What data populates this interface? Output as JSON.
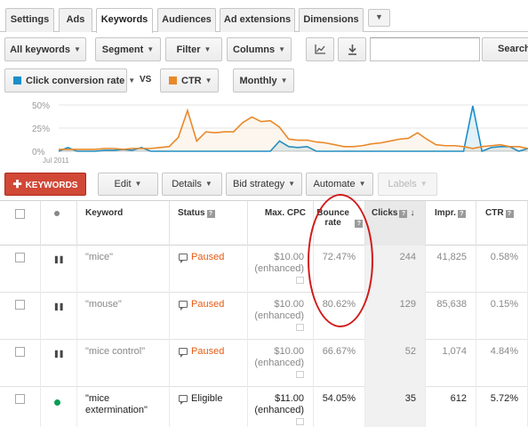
{
  "tabs": [
    {
      "label": "Settings"
    },
    {
      "label": "Ads"
    },
    {
      "label": "Keywords",
      "active": true
    },
    {
      "label": "Audiences"
    },
    {
      "label": "Ad extensions"
    },
    {
      "label": "Dimensions"
    }
  ],
  "toolbar": {
    "all_keywords": "All keywords",
    "segment": "Segment",
    "filter": "Filter",
    "columns": "Columns",
    "search_placeholder": "",
    "search_label": "Search"
  },
  "metrics": {
    "metric1": "Click conversion rate",
    "vs": "VS",
    "metric2": "CTR",
    "period": "Monthly",
    "metric1_color": "#1a8fc9",
    "metric2_color": "#e8892b"
  },
  "chart_data": {
    "type": "line",
    "y_ticks": [
      "50%",
      "25%",
      "0%"
    ],
    "x_tick": "Jul 2011",
    "ylim": [
      0,
      50
    ],
    "series": [
      {
        "name": "Click conversion rate",
        "color": "#1a8fc9",
        "values": [
          0,
          4,
          0,
          0,
          0,
          1,
          1,
          2,
          1,
          4,
          0,
          0,
          0,
          0,
          0,
          0,
          0,
          0,
          0,
          0,
          0,
          0,
          0,
          0,
          11,
          5,
          4,
          5,
          0,
          0,
          0,
          0,
          0,
          0,
          0,
          0,
          0,
          0,
          0,
          0,
          0,
          0,
          0,
          0,
          0,
          49,
          0,
          4,
          5,
          5,
          0,
          3
        ]
      },
      {
        "name": "CTR",
        "color": "#e8892b",
        "values": [
          2,
          2,
          2,
          2,
          2,
          3,
          3,
          2,
          3,
          3,
          3,
          4,
          5,
          15,
          44,
          11,
          21,
          20,
          21,
          21,
          31,
          37,
          32,
          33,
          26,
          13,
          12,
          12,
          10,
          9,
          7,
          5,
          5,
          6,
          8,
          9,
          11,
          13,
          14,
          20,
          13,
          7,
          6,
          6,
          5,
          3,
          5,
          6,
          7,
          5,
          5,
          3
        ]
      }
    ]
  },
  "actions": {
    "add_keywords": "KEYWORDS",
    "edit": "Edit",
    "details": "Details",
    "bid_strategy": "Bid strategy",
    "automate": "Automate",
    "labels": "Labels"
  },
  "table": {
    "headers": {
      "keyword": "Keyword",
      "status": "Status",
      "max_cpc": "Max. CPC",
      "bounce_rate": "Bounce rate",
      "clicks": "Clicks",
      "impr": "Impr.",
      "ctr": "CTR"
    },
    "rows": [
      {
        "keyword": "\"mice\"",
        "status": "Paused",
        "max_cpc": "$10.00",
        "cpc_note": "(enhanced)",
        "bounce_rate": "72.47%",
        "clicks": "244",
        "impr": "41,825",
        "ctr": "0.58%"
      },
      {
        "keyword": "\"mouse\"",
        "status": "Paused",
        "max_cpc": "$10.00",
        "cpc_note": "(enhanced)",
        "bounce_rate": "80.62%",
        "clicks": "129",
        "impr": "85,638",
        "ctr": "0.15%"
      },
      {
        "keyword": "\"mice control\"",
        "status": "Paused",
        "max_cpc": "$10.00",
        "cpc_note": "(enhanced)",
        "bounce_rate": "66.67%",
        "clicks": "52",
        "impr": "1,074",
        "ctr": "4.84%"
      },
      {
        "keyword": "\"mice extermination\"",
        "status": "Eligible",
        "max_cpc": "$11.00",
        "cpc_note": "(enhanced)",
        "bounce_rate": "54.05%",
        "clicks": "35",
        "impr": "612",
        "ctr": "5.72%"
      }
    ]
  },
  "colors": {
    "paused": "#e65b13",
    "eligible": "#222222",
    "eligible_dot": "#0a9d58",
    "keyword_active": "#222222",
    "keyword_paused": "#888888",
    "accent_red": "#d14836",
    "annotation_oval": "#d11a1a"
  }
}
